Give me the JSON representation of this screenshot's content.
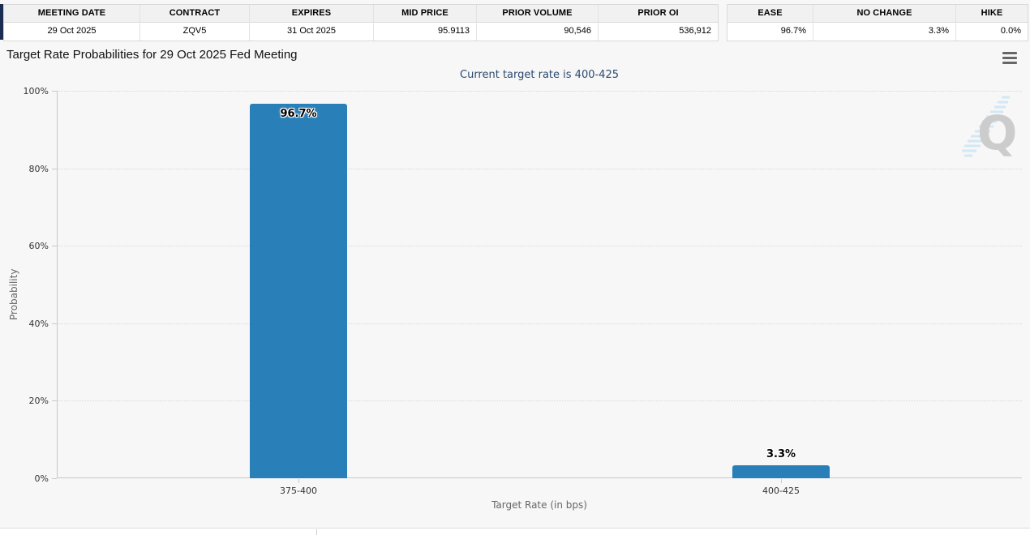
{
  "contract_table": {
    "headers": [
      "MEETING DATE",
      "CONTRACT",
      "EXPIRES",
      "MID PRICE",
      "PRIOR VOLUME",
      "PRIOR OI"
    ],
    "row": [
      "29 Oct 2025",
      "ZQV5",
      "31 Oct 2025",
      "95.9113",
      "90,546",
      "536,912"
    ]
  },
  "summary_table": {
    "headers": [
      "EASE",
      "NO CHANGE",
      "HIKE"
    ],
    "row": [
      "96.7%",
      "3.3%",
      "0.0%"
    ]
  },
  "chart_data": {
    "type": "bar",
    "title": "Target Rate Probabilities for 29 Oct 2025 Fed Meeting",
    "subtitle": "Current target rate is 400-425",
    "categories": [
      "375-400",
      "400-425"
    ],
    "values": [
      96.7,
      3.3
    ],
    "value_labels": [
      "96.7%",
      "3.3%"
    ],
    "xlabel": "Target Rate (in bps)",
    "ylabel": "Probability",
    "ylim": [
      0,
      100
    ],
    "ytick_labels": [
      "0%",
      "20%",
      "40%",
      "60%",
      "80%",
      "100%"
    ],
    "grid": "horizontal dotted gridlines every 20%",
    "legend": "none",
    "bar_color": "#2980b9",
    "subtitle_color": "#2b4a6f"
  },
  "icons": {
    "menu_icon": "hamburger-menu",
    "watermark_letter": "Q"
  }
}
